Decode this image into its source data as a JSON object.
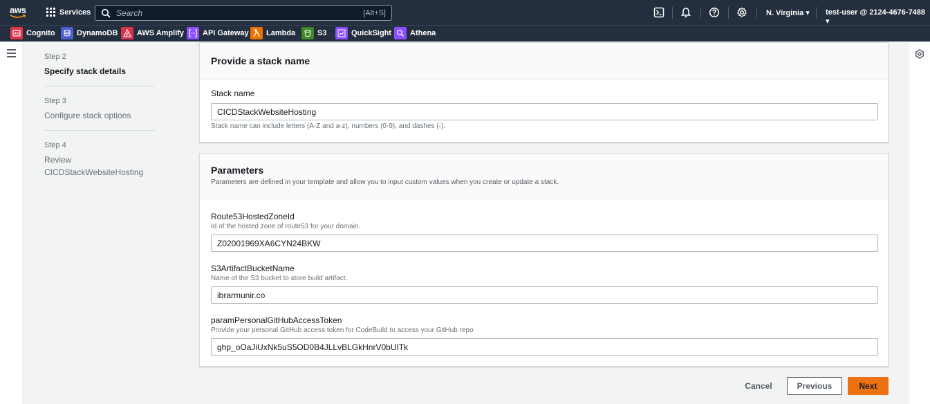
{
  "nav": {
    "brand": "aws",
    "services_label": "Services",
    "search_placeholder": "Search",
    "search_shortcut": "[Alt+S]",
    "region": "N. Virginia ▾",
    "account": "test-user @ 2124-4676-7488 ▾",
    "icons": [
      "cloudshell-icon",
      "bell-icon",
      "help-icon",
      "gear-icon"
    ]
  },
  "favorites": [
    {
      "label": "Cognito",
      "color": "#dd344c"
    },
    {
      "label": "DynamoDB",
      "color": "#4d5ed4"
    },
    {
      "label": "AWS Amplify",
      "color": "#dd344c"
    },
    {
      "label": "API Gateway",
      "color": "#8c4fff"
    },
    {
      "label": "Lambda",
      "color": "#ed7100"
    },
    {
      "label": "S3",
      "color": "#3f8624"
    },
    {
      "label": "QuickSight",
      "color": "#8c4fff"
    },
    {
      "label": "Athena",
      "color": "#8c4fff"
    }
  ],
  "steps": [
    {
      "num": "Step 2",
      "title": "Specify stack details",
      "active": true
    },
    {
      "num": "Step 3",
      "title": "Configure stack options",
      "active": false
    },
    {
      "num": "Step 4",
      "title": "Review",
      "sub": "CICDStackWebsiteHosting",
      "active": false
    }
  ],
  "stack_panel": {
    "title": "Provide a stack name",
    "field_label": "Stack name",
    "field_value": "CICDStackWebsiteHosting",
    "field_hint": "Stack name can include letters (A-Z and a-z), numbers (0-9), and dashes (-)."
  },
  "params_panel": {
    "title": "Parameters",
    "description": "Parameters are defined in your template and allow you to input custom values when you create or update a stack.",
    "fields": [
      {
        "label": "Route53HostedZoneId",
        "desc": "Id of the hosted zone of route53 for your domain.",
        "value": "Z02001969XA6CYN24BKW"
      },
      {
        "label": "S3ArtifactBucketName",
        "desc": "Name of the S3 bucket to store build artifact.",
        "value": "ibrarmunir.co"
      },
      {
        "label": "paramPersonalGitHubAccessToken",
        "desc": "Provide your personal GitHub access token for CodeBuild to access your GitHub repo",
        "value": "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"
      }
    ]
  },
  "actions": {
    "cancel": "Cancel",
    "previous": "Previous",
    "next": "Next"
  }
}
